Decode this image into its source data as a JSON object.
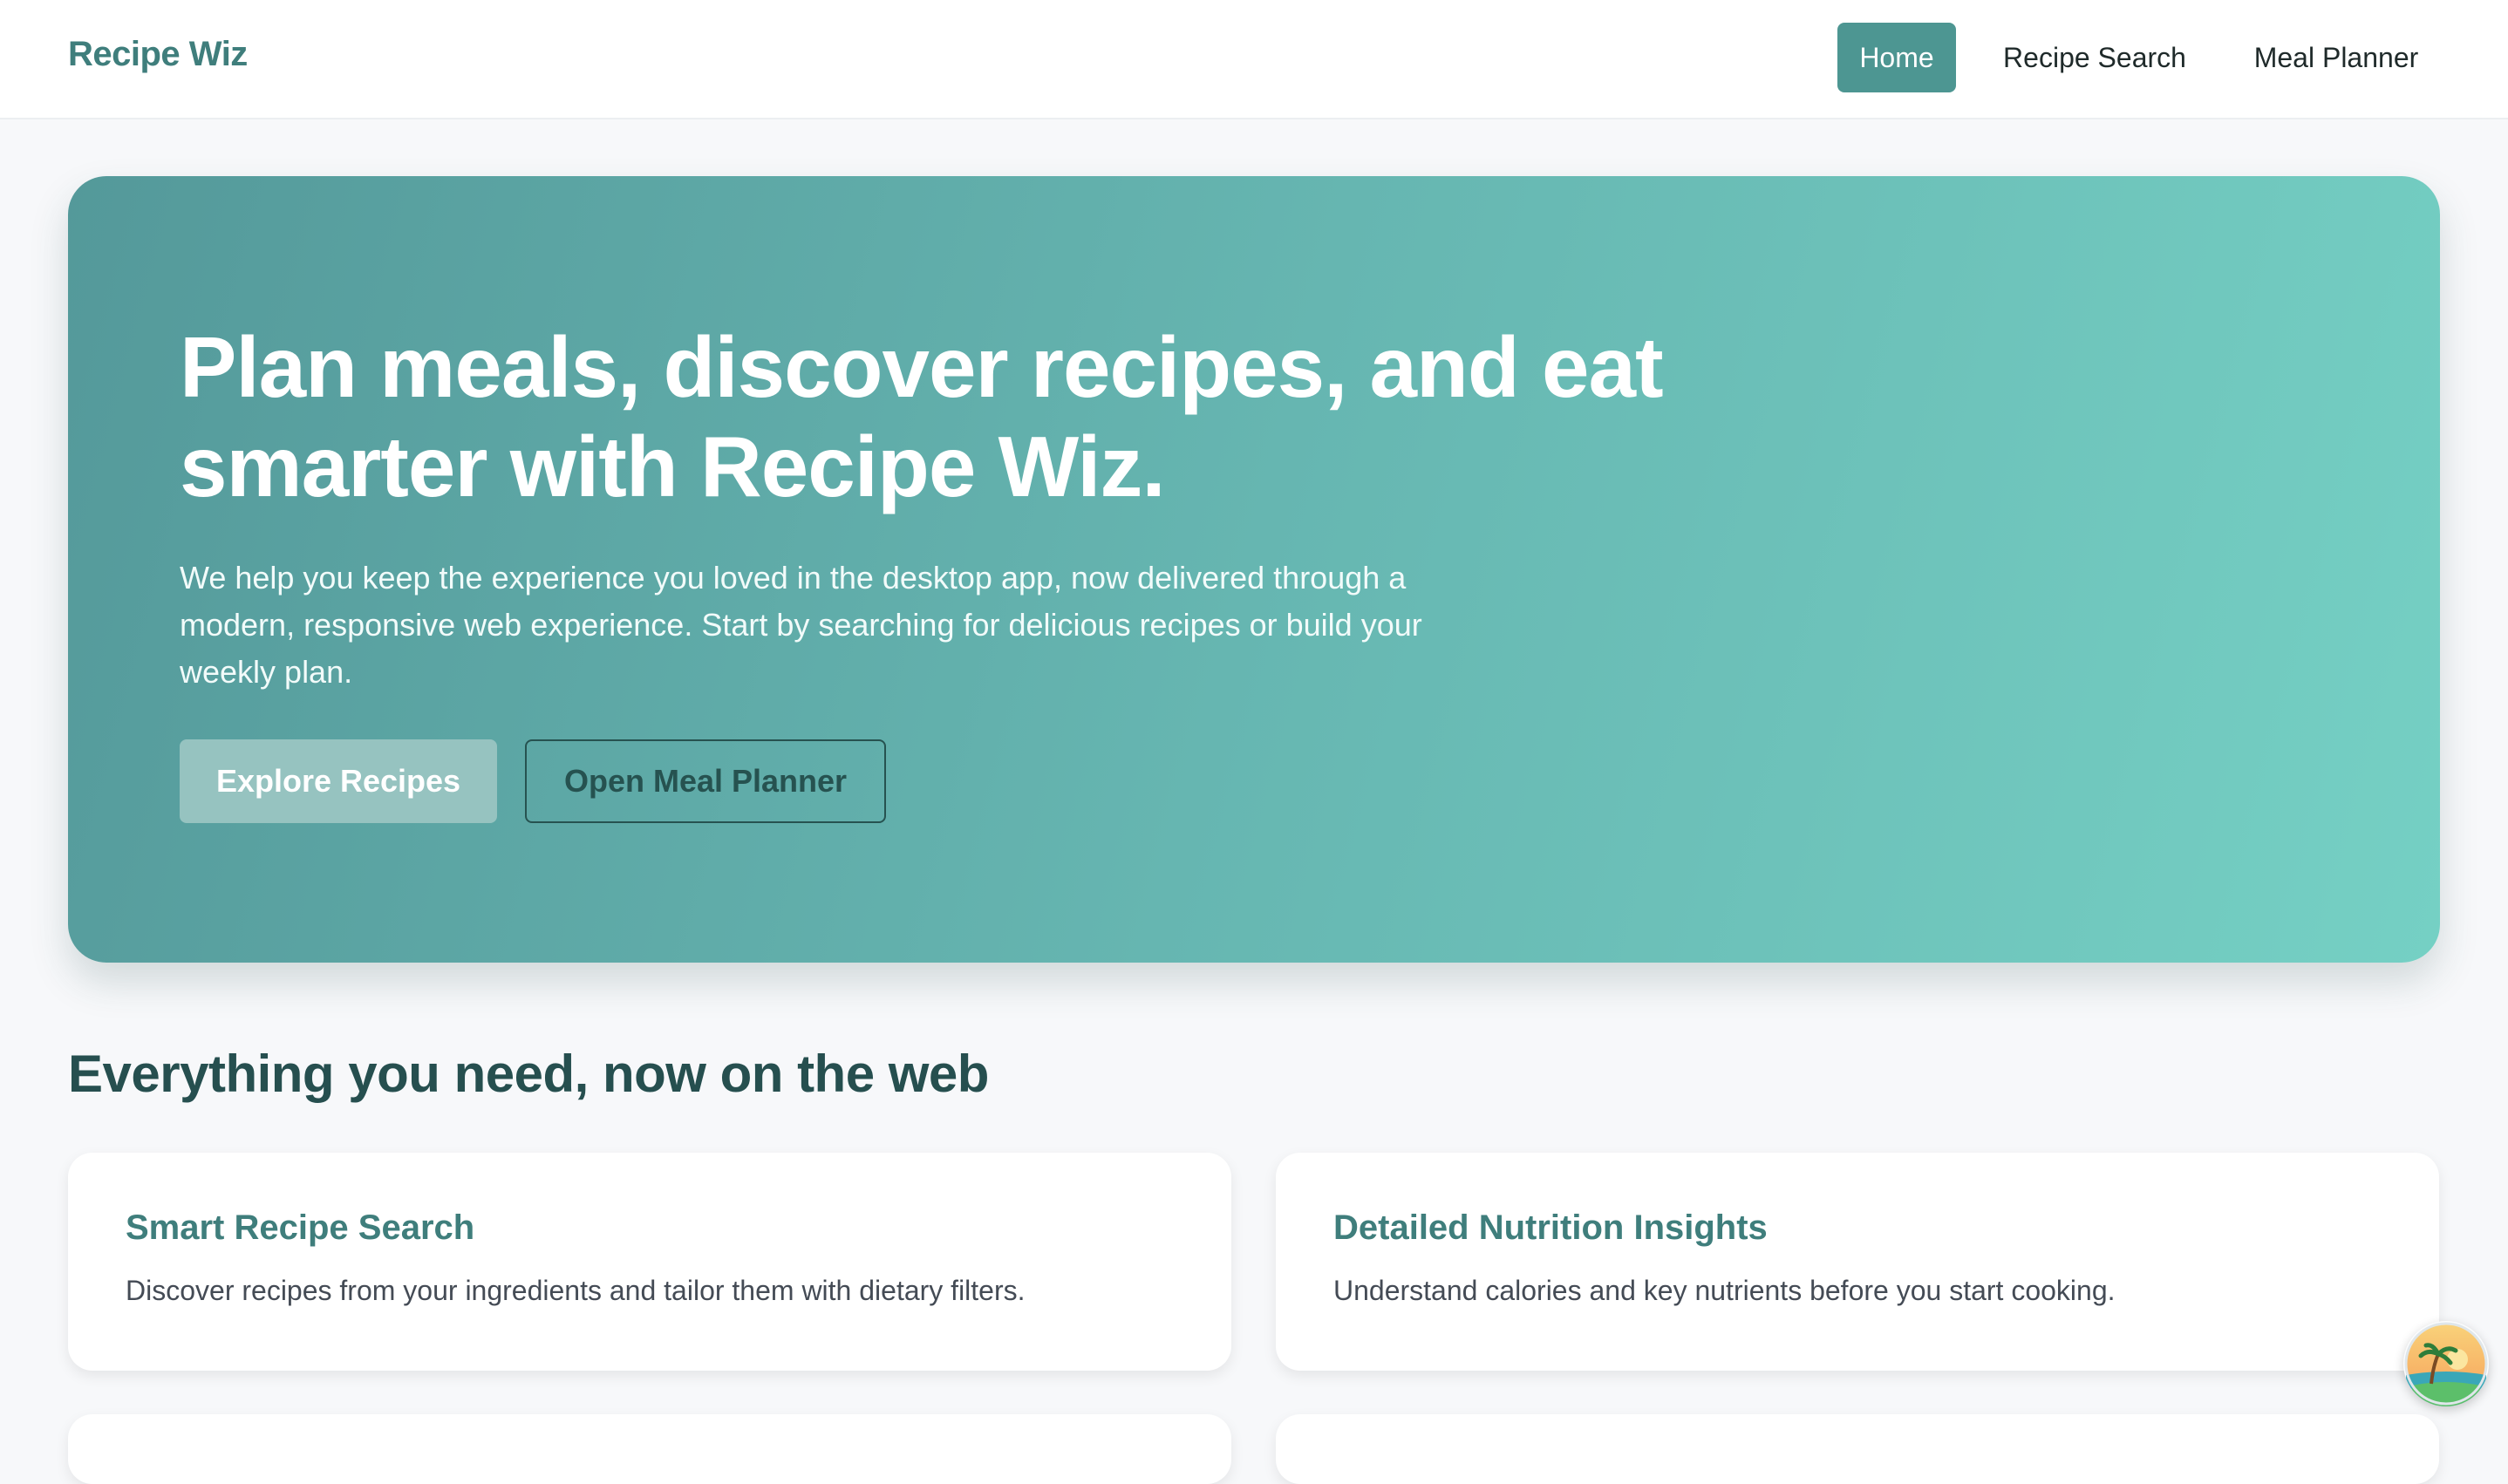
{
  "app": {
    "brand": "Recipe Wiz"
  },
  "nav": {
    "items": [
      {
        "label": "Home",
        "active": true
      },
      {
        "label": "Recipe Search",
        "active": false
      },
      {
        "label": "Meal Planner",
        "active": false
      }
    ]
  },
  "hero": {
    "title": "Plan meals, discover recipes, and eat smarter with Recipe Wiz.",
    "description": "We help you keep the experience you loved in the desktop app, now delivered through a modern, responsive web experience. Start by searching for delicious recipes or build your weekly plan.",
    "primary_button": "Explore Recipes",
    "secondary_button": "Open Meal Planner"
  },
  "features": {
    "heading": "Everything you need, now on the web",
    "cards": [
      {
        "title": "Smart Recipe Search",
        "text": "Discover recipes from your ingredients and tailor them with dietary filters."
      },
      {
        "title": "Detailed Nutrition Insights",
        "text": "Understand calories and key nutrients before you start cooking."
      }
    ]
  },
  "colors": {
    "accent": "#4d9692",
    "brand_text": "#3f7e7c",
    "hero_gradient_start": "#54999a",
    "hero_gradient_end": "#75d0c4",
    "heading": "#264f4f"
  },
  "icons": {
    "avatar": "beach-avatar-icon"
  }
}
